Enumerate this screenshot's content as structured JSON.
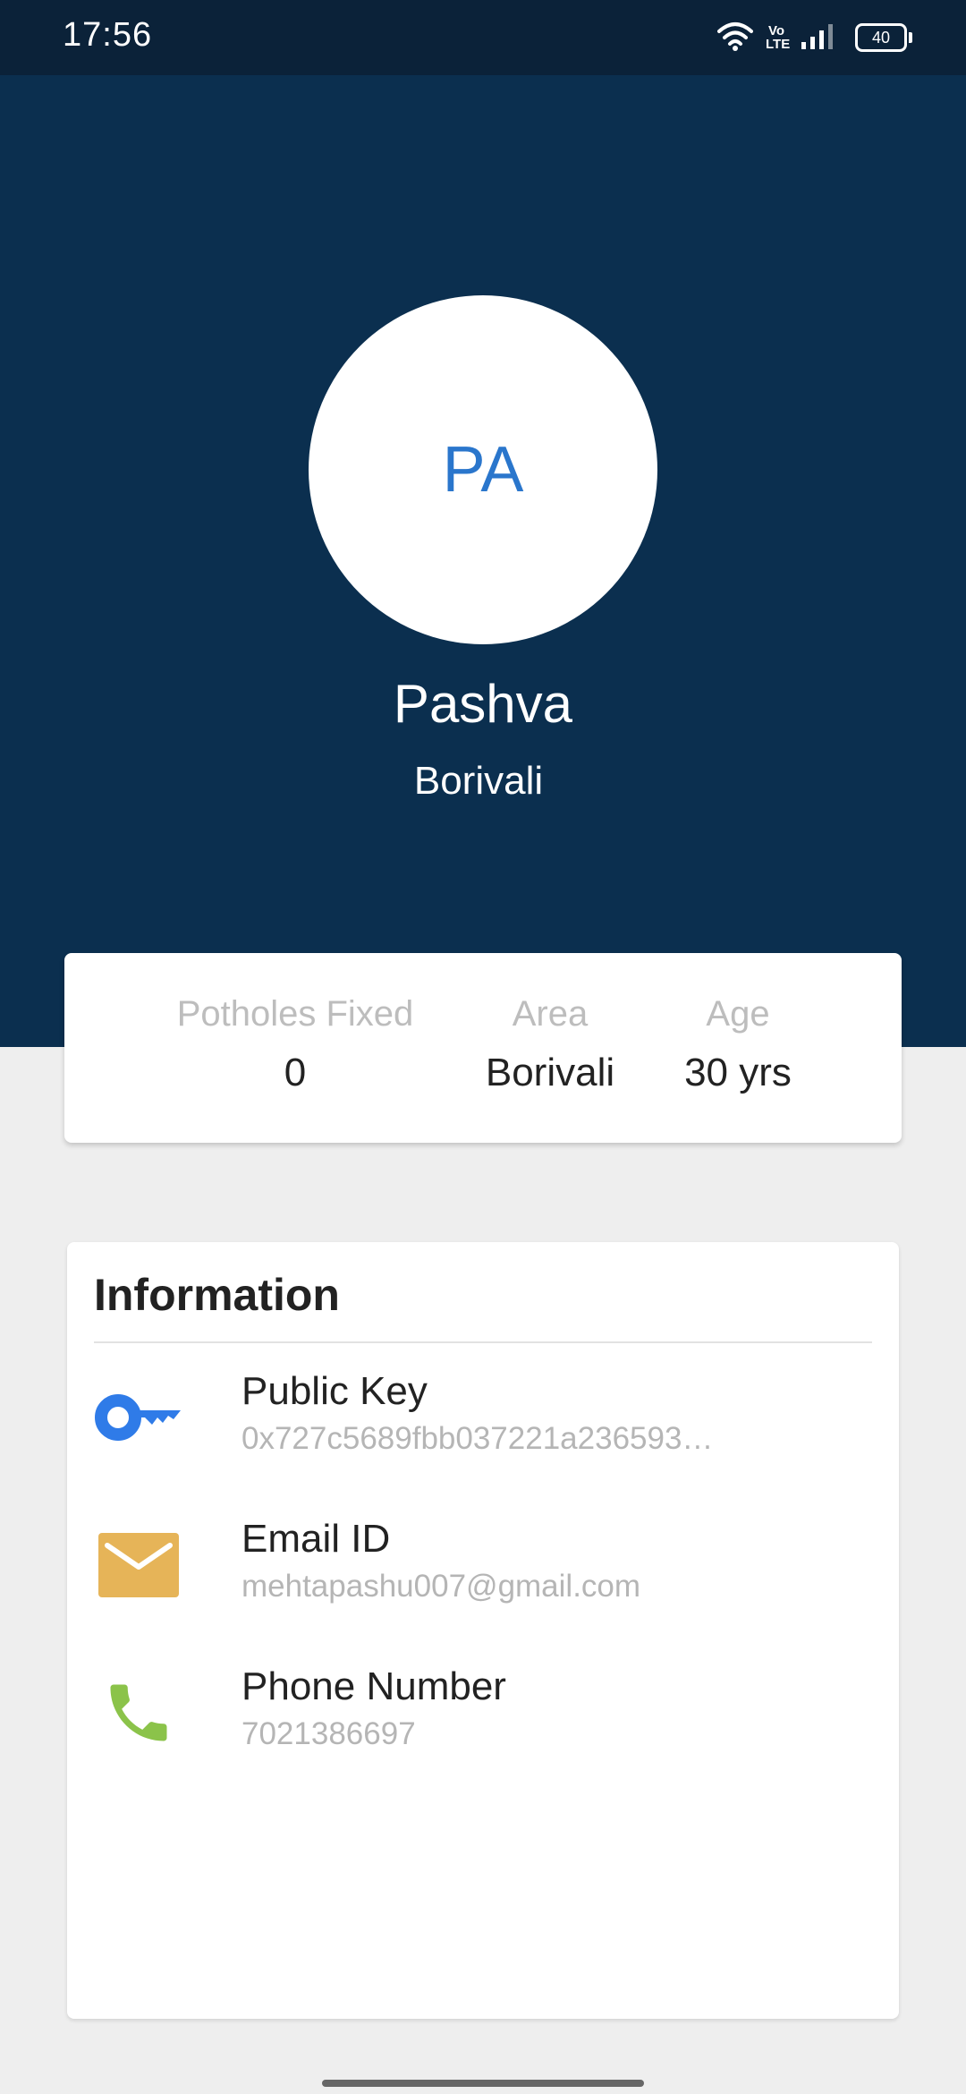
{
  "status_bar": {
    "time": "17:56",
    "volte_label": "Vo\nLTE",
    "battery": "40"
  },
  "profile": {
    "initials": "PA",
    "name": "Pashva",
    "area": "Borivali"
  },
  "stats": [
    {
      "label": "Potholes Fixed",
      "value": "0"
    },
    {
      "label": "Area",
      "value": "Borivali"
    },
    {
      "label": "Age",
      "value": "30 yrs"
    }
  ],
  "information": {
    "title": "Information",
    "items": [
      {
        "label": "Public Key",
        "value": "0x727c5689fbb037221a236593…",
        "icon": "key-icon"
      },
      {
        "label": "Email ID",
        "value": "mehtapashu007@gmail.com",
        "icon": "email-icon"
      },
      {
        "label": "Phone Number",
        "value": "7021386697",
        "icon": "phone-icon"
      }
    ]
  },
  "colors": {
    "header_bg": "#0b2f4f",
    "status_bar_bg": "#0b2239",
    "avatar_text": "#2a76cc",
    "key_icon": "#2f7be8",
    "email_icon": "#e6b458",
    "phone_icon": "#8bc34a"
  }
}
